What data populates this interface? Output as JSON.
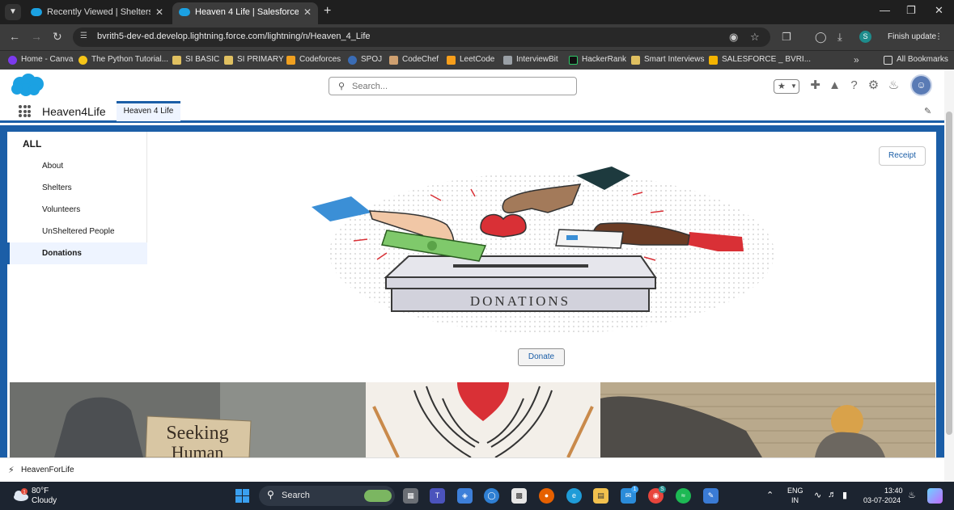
{
  "browser": {
    "tabs": [
      {
        "title": "Recently Viewed | Shelters | Sal"
      },
      {
        "title": "Heaven 4 Life | Salesforce"
      }
    ],
    "url": "bvrith5-dev-ed.develop.lightning.force.com/lightning/n/Heaven_4_Life",
    "finish_update_label": "Finish update",
    "profile_initial": "S",
    "bookmarks": [
      {
        "label": "Home - Canva",
        "color": "#7c3aed"
      },
      {
        "label": "The Python Tutorial...",
        "color": "#f5c518"
      },
      {
        "label": "SI BASIC",
        "color": "#e0c060"
      },
      {
        "label": "SI PRIMARY",
        "color": "#e0c060"
      },
      {
        "label": "Codeforces",
        "color": "#f0a020"
      },
      {
        "label": "SPOJ",
        "color": "#3a6cb5"
      },
      {
        "label": "CodeChef",
        "color": "#cfa070"
      },
      {
        "label": "LeetCode",
        "color": "#f89f1b"
      },
      {
        "label": "InterviewBit",
        "color": "#9aa0a6"
      },
      {
        "label": "HackerRank",
        "color": "#111111"
      },
      {
        "label": "Smart Interviews",
        "color": "#e0c060"
      },
      {
        "label": "SALESFORCE _ BVRI...",
        "color": "#f4b400"
      }
    ],
    "all_bookmarks_label": "All Bookmarks"
  },
  "salesforce": {
    "search_placeholder": "Search...",
    "app_name": "Heaven4Life",
    "nav_tab_label": "Heaven 4 Life",
    "accent_color": "#1b5ea7"
  },
  "sidebar": {
    "heading": "ALL",
    "items": [
      {
        "label": "About",
        "active": false
      },
      {
        "label": "Shelters",
        "active": false
      },
      {
        "label": "Volunteers",
        "active": false
      },
      {
        "label": "UnSheltered People",
        "active": false
      },
      {
        "label": "Donations",
        "active": true
      }
    ]
  },
  "main": {
    "receipt_label": "Receipt",
    "illustration_text": "DONATIONS",
    "donate_label": "Donate",
    "sign_text_line1": "Seeking",
    "sign_text_line2": "Human"
  },
  "utility_bar": {
    "label": "HeavenForLife"
  },
  "taskbar": {
    "temperature": "80°F",
    "condition": "Cloudy",
    "search_label": "Search",
    "lang_line1": "ENG",
    "lang_line2": "IN",
    "time": "13:40",
    "date": "03-07-2024",
    "weather_badge": "1",
    "store_badge": "1",
    "chrome_badge": "S"
  }
}
